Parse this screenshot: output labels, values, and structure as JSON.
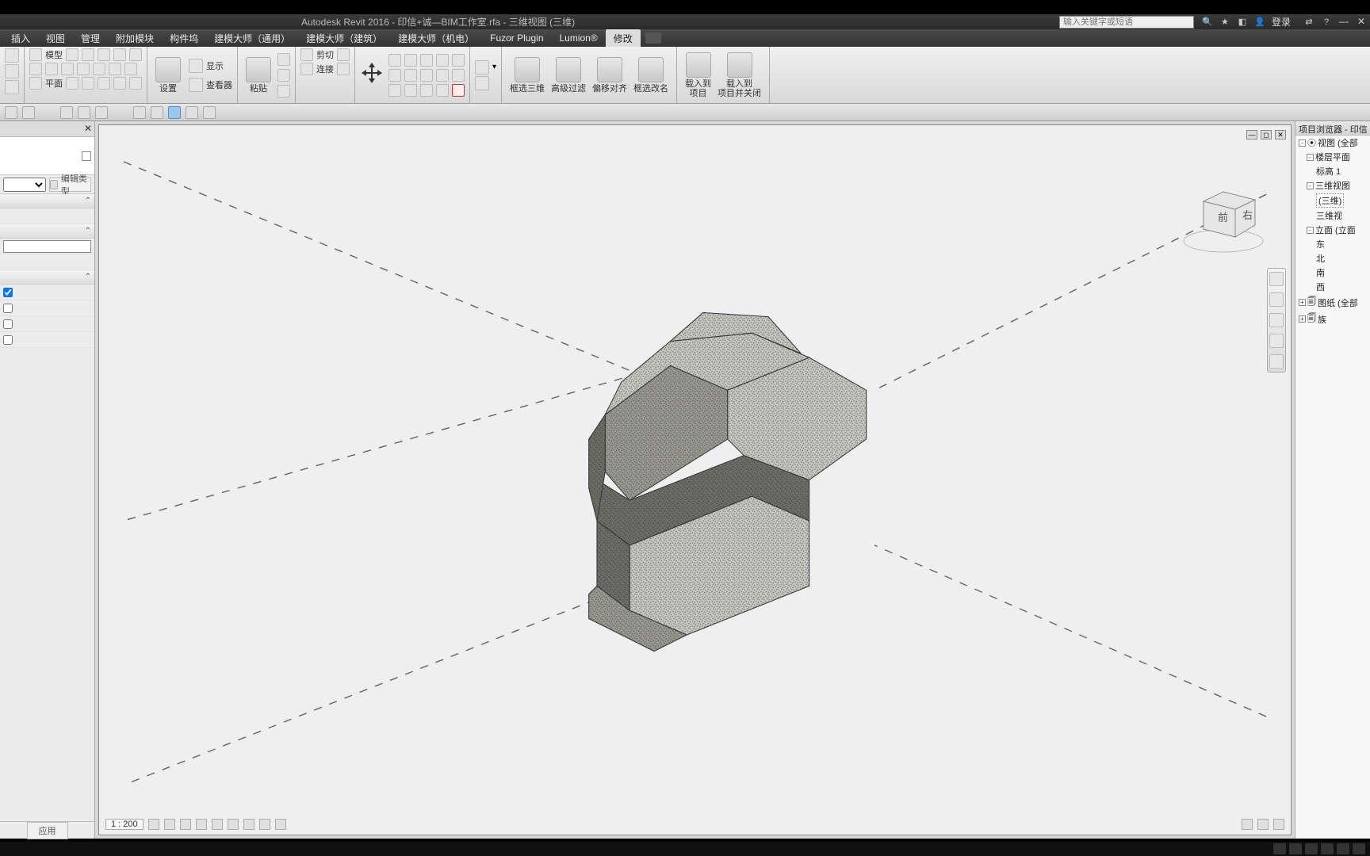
{
  "title": "Autodesk Revit 2016 -     印信+诚—BIM工作室.rfa - 三维视图 (三维)",
  "search_placeholder": "输入关键字或短语",
  "login": "登录",
  "menu": [
    "插入",
    "视图",
    "管理",
    "附加模块",
    "构件坞",
    "建模大师（通用）",
    "建模大师（建筑）",
    "建模大师（机电）",
    "Fuzor Plugin",
    "Lumion®",
    "修改"
  ],
  "menu_active_index": 10,
  "ribbon": {
    "model_label": "模型",
    "plane_label": "平面",
    "settings": "设置",
    "show": "显示",
    "viewer": "查看器",
    "paste": "粘贴",
    "cut": "剪切",
    "join": "连接",
    "select3d": "框选三维",
    "adv_filter": "高级过滤",
    "offset_align": "偏移对齐",
    "select_rename": "框选改名",
    "load_project": "载入到\n项目",
    "load_close": "载入到\n项目并关闭"
  },
  "props": {
    "edit_type": "编辑类型",
    "apply": "应用",
    "text_value": "",
    "checks": [
      true,
      false,
      false,
      false
    ]
  },
  "view": {
    "scale": "1 : 200",
    "cube_front": "前",
    "cube_right": "右"
  },
  "browser": {
    "title": "项目浏览器 - 印信",
    "views_all": "视图 (全部",
    "floor_plans": "楼层平面",
    "level": "标高 1",
    "three_d": "三维视图",
    "three_d_item": "(三维)",
    "three_d_item2": "三维视",
    "elevations": "立面 (立面",
    "east": "东",
    "north": "北",
    "south": "南",
    "west": "西",
    "sheets": "图纸 (全部",
    "families": "族"
  }
}
